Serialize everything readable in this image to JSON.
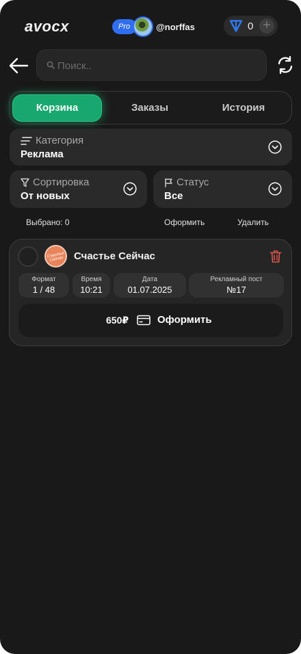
{
  "header": {
    "logo": "avocx",
    "pro_badge": "Pro",
    "username": "@norffas",
    "balance": "0",
    "currency_icon": "ton-icon",
    "accent_color": "#2f6ef0"
  },
  "search": {
    "placeholder": "Поиск.."
  },
  "tabs": [
    {
      "label": "Корзина",
      "active": true
    },
    {
      "label": "Заказы",
      "active": false
    },
    {
      "label": "История",
      "active": false
    }
  ],
  "filters": {
    "category": {
      "label": "Категория",
      "value": "Реклама"
    },
    "sort": {
      "label": "Сортировка",
      "value": "От новых"
    },
    "status": {
      "label": "Статус",
      "value": "Все"
    }
  },
  "selection": {
    "selected_text": "Выбрано: 0",
    "checkout_label": "Оформить",
    "delete_label": "Удалить"
  },
  "cart_items": [
    {
      "channel_name": "Счастье Сейчас",
      "avatar_text": "Счастье Сейчас",
      "details": [
        {
          "key": "Формат",
          "value": "1 / 48"
        },
        {
          "key": "Время",
          "value": "10:21"
        },
        {
          "key": "Дата",
          "value": "01.07.2025"
        },
        {
          "key": "Рекламный пост",
          "value": "№17"
        }
      ],
      "price": "650₽",
      "action_label": "Оформить"
    }
  ],
  "colors": {
    "active_tab": "#17a86e",
    "delete_icon": "#e0574f",
    "background": "#191919"
  }
}
